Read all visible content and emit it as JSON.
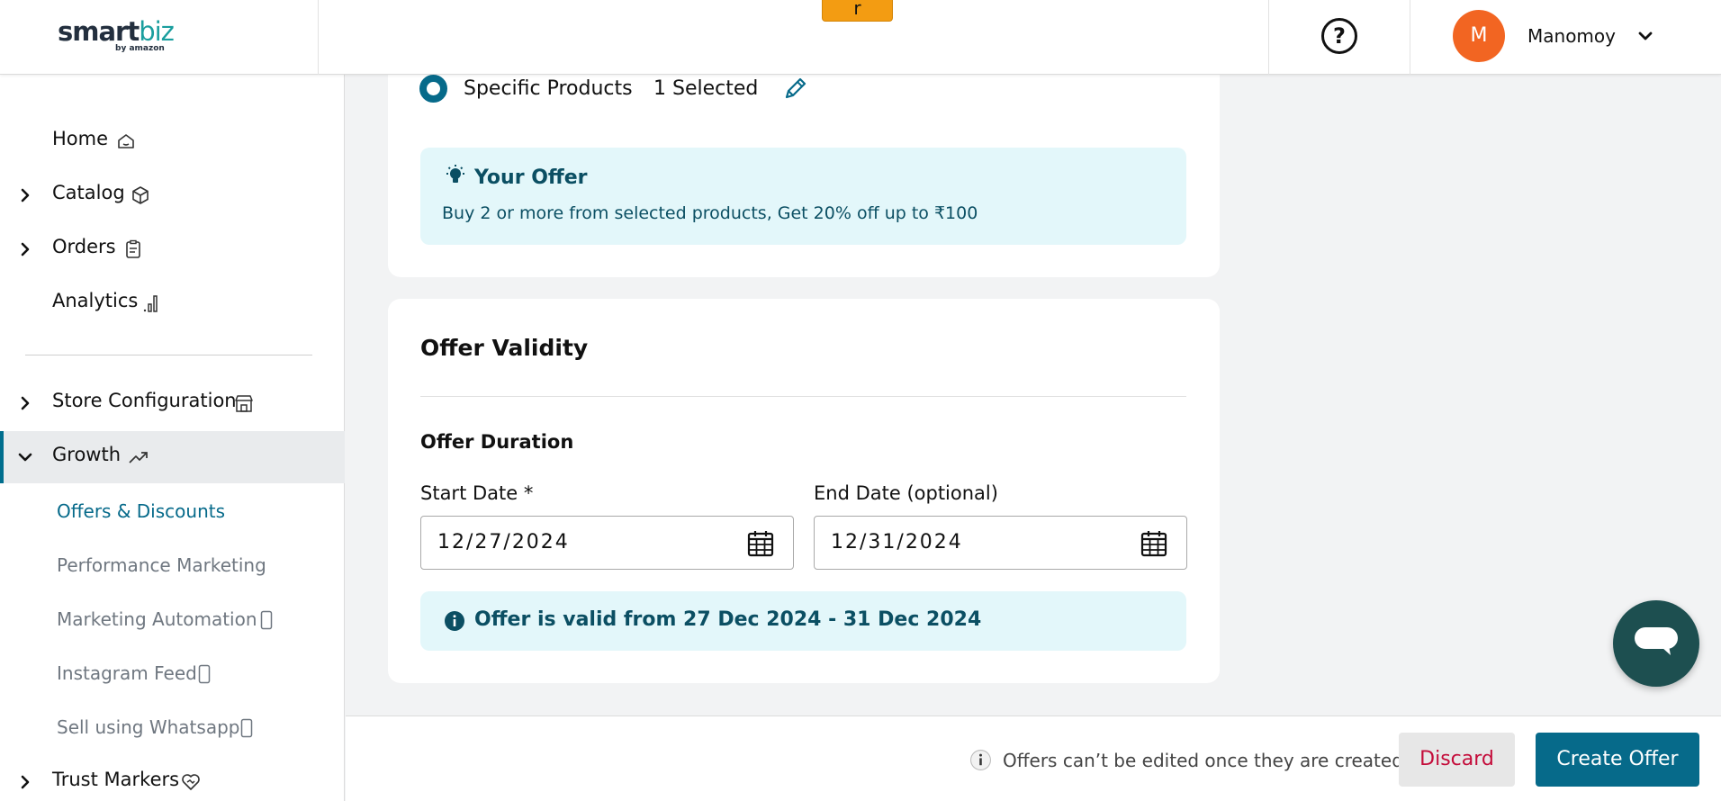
{
  "header": {
    "logo_smart": "smart",
    "logo_biz": "biz",
    "logo_sub": "by amazon",
    "floating_tag": "r",
    "help_glyph": "?",
    "avatar_initial": "M",
    "user_name": "Manomoy"
  },
  "sidebar": {
    "items": [
      {
        "label": "Home",
        "icon": "home-icon",
        "expandable": false
      },
      {
        "label": "Catalog",
        "icon": "cube-icon",
        "expandable": true
      },
      {
        "label": "Orders",
        "icon": "clipboard-icon",
        "expandable": true
      },
      {
        "label": "Analytics",
        "icon": "bar-chart-icon",
        "expandable": false
      },
      {
        "label": "Store Configuration",
        "icon": "store-icon",
        "expandable": true
      },
      {
        "label": "Growth",
        "icon": "trend-up-icon",
        "expandable": true,
        "expanded": true,
        "active": true
      },
      {
        "label": "Trust Markers",
        "icon": "heart-handshake-icon",
        "expandable": true
      }
    ],
    "sub_items": [
      {
        "label": "Offers & Discounts",
        "active": true
      },
      {
        "label": "Performance Marketing"
      },
      {
        "label": "Marketing Automation",
        "icon": "mobile-icon"
      },
      {
        "label": "Instagram Feed",
        "icon": "mobile-icon"
      },
      {
        "label": "Sell using Whatsapp",
        "icon": "mobile-icon"
      }
    ]
  },
  "applicability": {
    "option_label": "Specific Products",
    "selected_count": "1 Selected"
  },
  "your_offer": {
    "title": "Your Offer",
    "description": "Buy 2 or more from selected products, Get 20% off up to ₹100"
  },
  "validity": {
    "title": "Offer Validity",
    "duration_title": "Offer Duration",
    "start_label": "Start Date *",
    "start_value": "12/27/2024",
    "end_label": "End Date (optional)",
    "end_value": "12/31/2024",
    "summary": "Offer is valid from 27 Dec 2024 - 31 Dec 2024"
  },
  "footer": {
    "note": "Offers can’t be edited once they are created",
    "discard_label": "Discard",
    "create_label": "Create Offer"
  },
  "colors": {
    "primary": "#066a8a",
    "discard_text": "#c40c3a",
    "avatar_bg": "#f26522",
    "info_bg": "#e3f7fa",
    "chat_bg": "#1d4f50"
  }
}
